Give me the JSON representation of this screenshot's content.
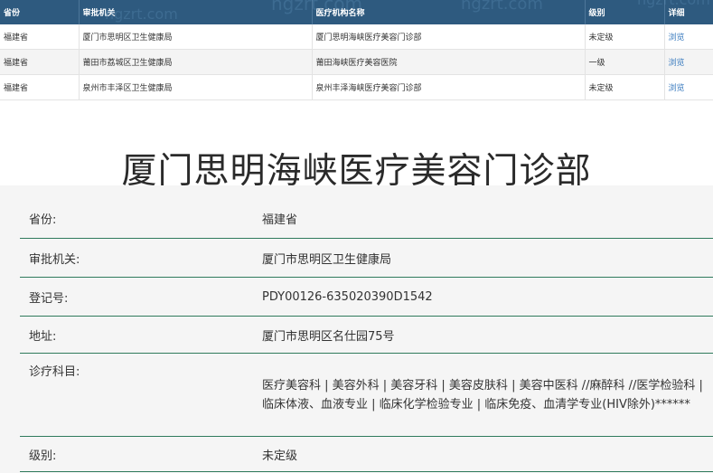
{
  "list": {
    "headers": [
      "省份",
      "审批机关",
      "医疗机构名称",
      "级别",
      "详细"
    ],
    "rows": [
      [
        "福建省",
        "厦门市思明区卫生健康局",
        "厦门思明海峡医疗美容门诊部",
        "未定级",
        "浏览"
      ],
      [
        "福建省",
        "莆田市荔城区卫生健康局",
        "莆田海峡医疗美容医院",
        "一级",
        "浏览"
      ],
      [
        "福建省",
        "泉州市丰泽区卫生健康局",
        "泉州丰泽海峡医疗美容门诊部",
        "未定级",
        "浏览"
      ]
    ]
  },
  "watermark": {
    "text": "ngzrt.com"
  },
  "title": "厦门思明海峡医疗美容门诊部",
  "details": [
    {
      "label": "省份:",
      "value": "福建省"
    },
    {
      "label": "审批机关:",
      "value": "厦门市思明区卫生健康局"
    },
    {
      "label": "登记号:",
      "value": "PDY00126-635020390D1542"
    },
    {
      "label": "地址:",
      "value": "厦门市思明区名仕园75号"
    },
    {
      "label": "诊疗科目:",
      "value": "医疗美容科 | 美容外科 | 美容牙科 | 美容皮肤科 | 美容中医科 //麻醉科 //医学检验科 | 临床体液、血液专业 | 临床化学检验专业 | 临床免疫、血清学专业(HIV除外)******"
    },
    {
      "label": "级别:",
      "value": "未定级"
    }
  ],
  "colors": {
    "header_bg": "#2e5a7f",
    "link": "#3a7bbf",
    "detail_bg": "#f5f5f5",
    "row_divider": "#2f7a5c"
  }
}
